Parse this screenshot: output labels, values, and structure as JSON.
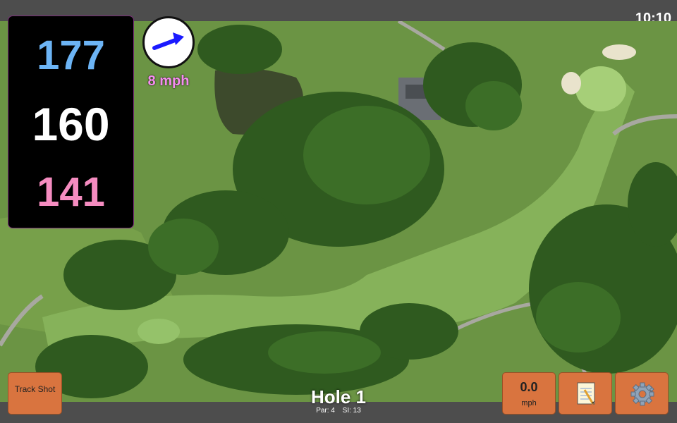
{
  "clock": "10:10",
  "yardages": {
    "back": "177",
    "middle": "160",
    "front": "141",
    "colors": {
      "back": "#6cb4f5",
      "middle": "#ffffff",
      "front": "#f58cc0"
    }
  },
  "wind": {
    "speed": "8 mph",
    "color": "#f58cf0",
    "arrow_color": "#1a1aff",
    "direction_icon": "wind-arrow-icon"
  },
  "buttons": {
    "track_shot": "Track Shot",
    "swing_speed_value": "0.0",
    "swing_speed_unit": "mph",
    "notes_icon": "notepad-icon",
    "settings_icon": "gear-icon"
  },
  "hole": {
    "title": "Hole 1",
    "par": "Par: 4",
    "si": "SI: 13"
  },
  "colors": {
    "button_bg": "#d9743f",
    "bar_bg": "#4d4d4d"
  }
}
